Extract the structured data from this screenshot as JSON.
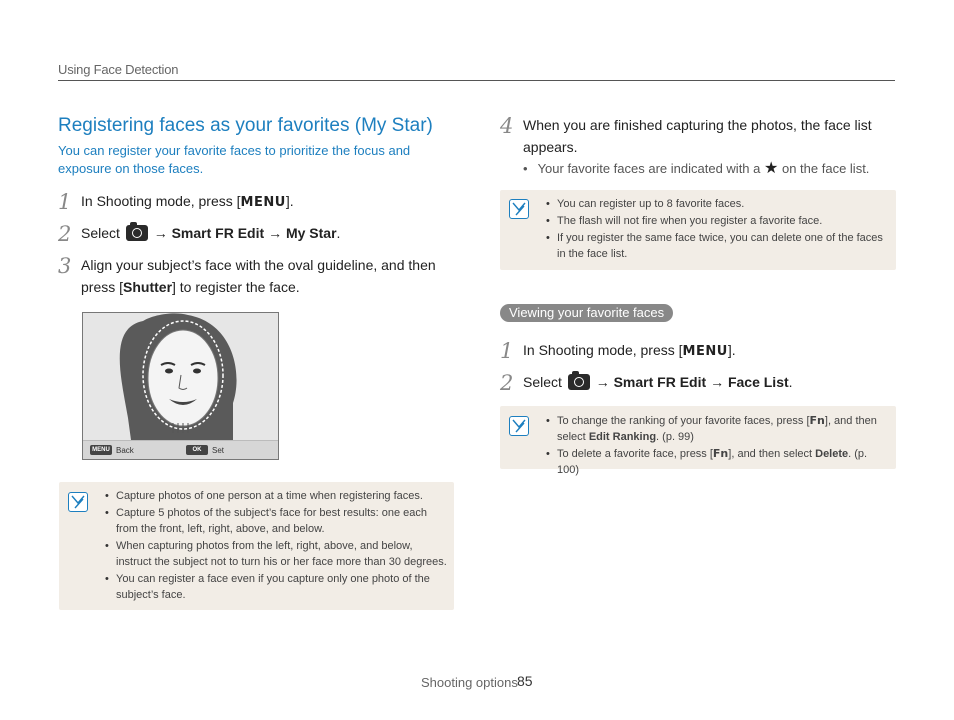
{
  "header": {
    "section": "Using Face Detection"
  },
  "left": {
    "title": "Registering faces as your favorites (My Star)",
    "intro": "You can register your favorite faces to prioritize the focus and exposure on those faces.",
    "step1": {
      "num": "1",
      "pre": "In Shooting mode, press [",
      "key": "MENU",
      "post": "]."
    },
    "step2": {
      "num": "2",
      "pre": "Select",
      "arrow1": "→",
      "item1": "Smart FR Edit",
      "arrow2": "→",
      "item2": "My Star",
      "post": "."
    },
    "step3": {
      "num": "3",
      "line1": "Align your subject’s face with the oval guideline, and then",
      "pre2": "press [",
      "key": "Shutter",
      "post2": "] to register the face."
    },
    "preview": {
      "back_key": "MENU",
      "back_label": "Back",
      "set_key": "OK",
      "set_label": "Set"
    },
    "notes": [
      "Capture photos of one person at a time when registering faces.",
      "Capture 5 photos of the subject’s face for best results: one each from the front, left, right, above, and below.",
      "When capturing photos from the left, right, above, and below, instruct the subject not to turn his or her face more than 30 degrees.",
      "You can register a face even if you capture only one photo of the subject’s face."
    ]
  },
  "right": {
    "step4": {
      "num": "4",
      "text": "When you are finished capturing the photos, the face list appears.",
      "bullet_pre": "Your favorite faces are indicated with a",
      "star": "★",
      "bullet_post": "on the face list."
    },
    "notes1": [
      "You can register up to 8 favorite faces.",
      "The flash will not fire when you register a favorite face.",
      "If you register the same face twice, you can delete one of the faces in the face list."
    ],
    "subsection": "Viewing your favorite faces",
    "step1": {
      "num": "1",
      "pre": "In Shooting mode, press [",
      "key": "MENU",
      "post": "]."
    },
    "step2": {
      "num": "2",
      "pre": "Select",
      "arrow1": "→",
      "item1": "Smart FR Edit",
      "arrow2": "→",
      "item2": "Face List",
      "post": "."
    },
    "notes2": {
      "n1_pre": "To change the ranking of your favorite faces, press [",
      "n1_key": "Fn",
      "n1_mid": "], and then select",
      "n1_bold": "Edit Ranking",
      "n1_post": ". (p. 99)",
      "n2_pre": "To delete a favorite face, press [",
      "n2_key": "Fn",
      "n2_mid": "], and then select",
      "n2_bold": "Delete",
      "n2_post": ". (p. 100)"
    }
  },
  "footer": {
    "label": "Shooting options",
    "page": "85"
  },
  "colors": {
    "accent": "#1d7fbf",
    "note_bg": "#f2ede6"
  }
}
